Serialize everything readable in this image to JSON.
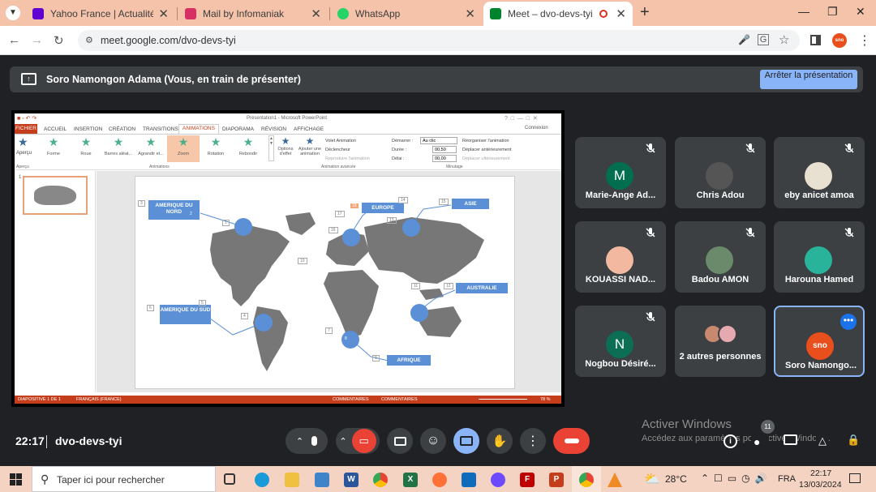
{
  "tabs": [
    {
      "title": "Yahoo France | Actualités, mail e...",
      "color": "#6001d2"
    },
    {
      "title": "Mail by Infomaniak",
      "color": "#d63064"
    },
    {
      "title": "WhatsApp",
      "color": "#25d366"
    },
    {
      "title": "Meet – dvo-devs-tyi",
      "color": "#00832d"
    }
  ],
  "new_tab": "+",
  "url": "meet.google.com/dvo-devs-tyi",
  "presenting": {
    "text": "Soro Namongon Adama (Vous, en train de présenter)",
    "stop_button": "Arrêter la présentation"
  },
  "ppt": {
    "title": "Présentation1 - Microsoft PowerPoint",
    "file_tab": "FICHIER",
    "ribbon_tabs": [
      "ACCUEIL",
      "INSERTION",
      "CRÉATION",
      "TRANSITIONS",
      "ANIMATIONS",
      "DIAPORAMA",
      "RÉVISION",
      "AFFICHAGE"
    ],
    "connexion": "Connexion",
    "apercu": "Aperçu",
    "effects": [
      "Forme",
      "Roue",
      "Barres aléat...",
      "Agrandir et...",
      "Zoom",
      "Rotation",
      "Rebondir"
    ],
    "options_effet": "Options d'effet",
    "ajouter_animation": "Ajouter une animation",
    "adv": [
      "Volet Animation",
      "Déclencheur",
      "Reproduire l'animation"
    ],
    "timing_labels": [
      "Démarrer :",
      "Durée :",
      "Délai :"
    ],
    "timing_values": [
      "Au clic",
      "00,50",
      "00,00"
    ],
    "reorder": [
      "Réorganiser l'animation",
      "Déplacer antérieurement",
      "Déplacer ultérieurement"
    ],
    "groups": [
      "Aperçu",
      "Animations",
      "Animation avancée",
      "Minutage"
    ],
    "slide_num": "1",
    "labels": {
      "na": "AMERIQUE DU NORD",
      "europe": "EUROPE",
      "asie": "ASIE",
      "australie": "AUSTRALIE",
      "sa": "AMERIQUE DU SUD",
      "afrique": "AFRIQUE"
    },
    "nums": [
      "1",
      "2",
      "3",
      "4",
      "5",
      "6",
      "7",
      "8",
      "9",
      "10",
      "11",
      "12",
      "13",
      "14",
      "15",
      "16",
      "17",
      "18"
    ],
    "status_left": "DIAPOSITIVE 1 DE 1",
    "status_lang": "FRANÇAIS (FRANCE)",
    "status_notes": "COMMENTAIRES",
    "status_comments": "COMMENTAIRES",
    "zoom": "78 %"
  },
  "participants": [
    {
      "name": "Marie-Ange Ad...",
      "initial": "M",
      "color": "#006e4f",
      "muted": true
    },
    {
      "name": "Chris Adou",
      "initial": "",
      "color": "#555",
      "muted": true
    },
    {
      "name": "eby anicet amoa",
      "initial": "",
      "color": "#e8e0d0",
      "muted": true
    },
    {
      "name": "KOUASSI NAD...",
      "initial": "",
      "color": "#f2b8a0",
      "muted": true
    },
    {
      "name": "Badou AMON",
      "initial": "",
      "color": "#6b8a6b",
      "muted": true
    },
    {
      "name": "Harouna Hamed",
      "initial": "",
      "color": "#2ab39b",
      "muted": true
    },
    {
      "name": "Nogbou Désiré...",
      "initial": "N",
      "color": "#0b6e55",
      "muted": true
    },
    {
      "name": "2 autres personnes",
      "initial": "",
      "color": "#aaa",
      "muted": false
    },
    {
      "name": "Soro Namongo...",
      "initial": "",
      "color": "#e84f1c",
      "muted": false
    }
  ],
  "bottom": {
    "time": "22:17",
    "meeting": "dvo-devs-tyi",
    "badge": "11"
  },
  "watermark": {
    "line1": "Activer Windows",
    "line2": "Accédez aux paramètres pour activer Windows."
  },
  "taskbar": {
    "search": "Taper ici pour rechercher",
    "temp": "28°C",
    "lang": "FRA",
    "time": "22:17",
    "date": "13/03/2024"
  }
}
